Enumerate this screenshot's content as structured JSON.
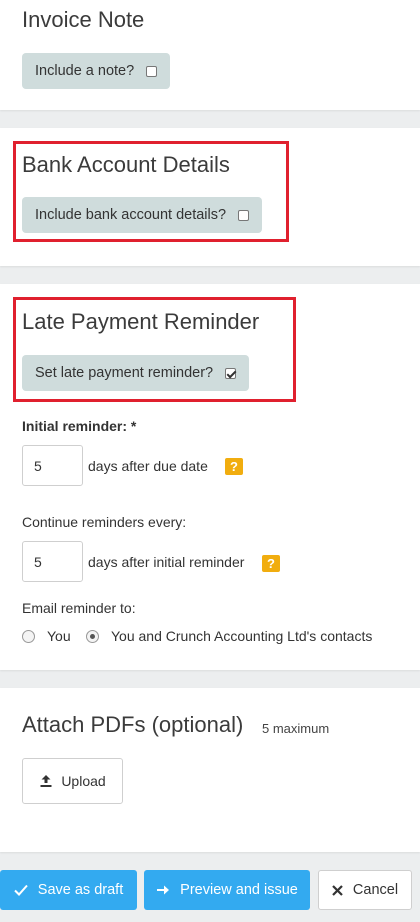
{
  "invoice_note": {
    "title": "Invoice Note",
    "toggle_label": "Include a note?",
    "checked": false
  },
  "bank_details": {
    "title": "Bank Account Details",
    "toggle_label": "Include bank account details?",
    "checked": false
  },
  "late_payment": {
    "title": "Late Payment Reminder",
    "toggle_label": "Set late payment reminder?",
    "checked": true,
    "initial_reminder_label": "Initial reminder: *",
    "initial_reminder_value": "5",
    "initial_reminder_suffix": "days after due date",
    "continue_label": "Continue reminders every:",
    "continue_value": "5",
    "continue_suffix": "days after initial reminder",
    "help_glyph": "?",
    "email_label": "Email reminder to:",
    "email_options": [
      {
        "label": "You",
        "selected": false
      },
      {
        "label": "You and Crunch Accounting Ltd's contacts",
        "selected": true
      }
    ]
  },
  "attachments": {
    "title": "Attach PDFs (optional)",
    "limit_note": "5 maximum",
    "upload_label": "Upload"
  },
  "footer": {
    "save_draft_label": "Save as draft",
    "preview_label": "Preview and issue",
    "cancel_label": "Cancel"
  },
  "colors": {
    "highlight": "#e0202e",
    "primary": "#33aaf0",
    "toggle_bg": "#cfdcdc",
    "help": "#f1ad0f"
  }
}
